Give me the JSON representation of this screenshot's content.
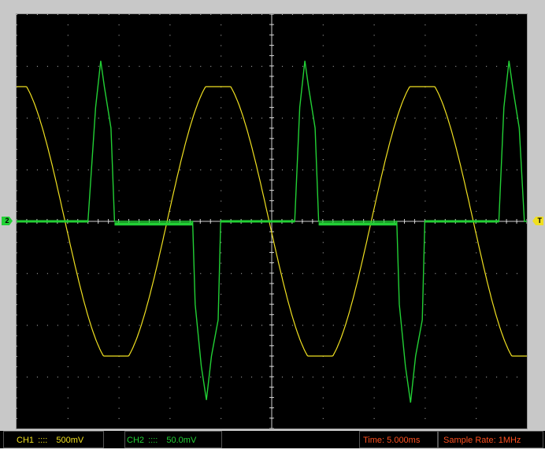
{
  "markers": {
    "ch2": "2",
    "trigger": "T"
  },
  "status": {
    "ch1_label": "CH1",
    "ch1_coupling": "::::",
    "ch1_scale": "500mV",
    "ch2_label": "CH2",
    "ch2_coupling": "::::",
    "ch2_scale": "50.0mV",
    "time": "Time: 5.000ms",
    "sample_rate": "Sample Rate: 1MHz"
  },
  "colors": {
    "ch1": "#f0e020",
    "ch2": "#22d035",
    "grid": "#bfbfbf",
    "status_text": "#ff5020"
  },
  "chart_data": {
    "type": "line",
    "grid_divisions": {
      "x": 10,
      "y": 8
    },
    "grid": true,
    "x_range_div": [
      0,
      10
    ],
    "y_range_div": [
      -4,
      4
    ],
    "series": [
      {
        "name": "CH1",
        "color": "#f0e020",
        "shape": "sine",
        "amplitude_div": 2.6,
        "period_div": 4.0,
        "phase_div": -1.05,
        "clip_div": 2.6
      },
      {
        "name": "CH2",
        "color": "#22d035",
        "points": [
          [
            0,
            0
          ],
          [
            1.4,
            0
          ],
          [
            1.55,
            2.2
          ],
          [
            1.65,
            3.1
          ],
          [
            1.72,
            2.6
          ],
          [
            1.85,
            1.8
          ],
          [
            1.92,
            0
          ],
          [
            3.45,
            0
          ],
          [
            3.5,
            -1.6
          ],
          [
            3.62,
            -2.8
          ],
          [
            3.72,
            -3.45
          ],
          [
            3.82,
            -2.6
          ],
          [
            3.95,
            -1.9
          ],
          [
            4.0,
            0
          ],
          [
            5.45,
            0
          ],
          [
            5.55,
            2.2
          ],
          [
            5.65,
            3.1
          ],
          [
            5.72,
            2.6
          ],
          [
            5.85,
            1.8
          ],
          [
            5.92,
            0
          ],
          [
            7.45,
            0
          ],
          [
            7.5,
            -1.6
          ],
          [
            7.62,
            -2.8
          ],
          [
            7.72,
            -3.5
          ],
          [
            7.82,
            -2.6
          ],
          [
            7.95,
            -1.9
          ],
          [
            8.0,
            0
          ],
          [
            9.45,
            0
          ],
          [
            9.55,
            2.2
          ],
          [
            9.65,
            3.1
          ],
          [
            9.72,
            2.6
          ],
          [
            9.85,
            1.8
          ],
          [
            9.95,
            0
          ],
          [
            10,
            0
          ]
        ]
      }
    ]
  }
}
